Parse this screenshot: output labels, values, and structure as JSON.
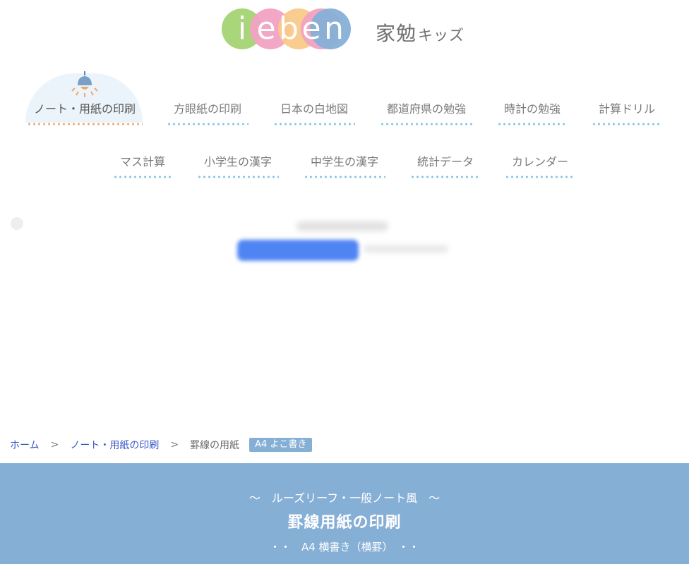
{
  "logo": {
    "letters": [
      "i",
      "e",
      "b",
      "e",
      "n"
    ],
    "colors": [
      "#a9d67a",
      "#f2a2c3",
      "#f9c98a",
      "#f2a2c3",
      "#86afd6"
    ],
    "kanji": "家勉",
    "kana": "キッズ"
  },
  "nav": {
    "row1": [
      {
        "label": "ノート・用紙の印刷",
        "active": true
      },
      {
        "label": "方眼紙の印刷"
      },
      {
        "label": "日本の白地図"
      },
      {
        "label": "都道府県の勉強"
      },
      {
        "label": "時計の勉強"
      },
      {
        "label": "計算ドリル"
      }
    ],
    "row2": [
      {
        "label": "マス計算"
      },
      {
        "label": "小学生の漢字"
      },
      {
        "label": "中学生の漢字"
      },
      {
        "label": "統計データ"
      },
      {
        "label": "カレンダー"
      }
    ],
    "active_icon": "lamp-icon"
  },
  "breadcrumb": {
    "home": "ホーム",
    "separator": ">",
    "category": "ノート・用紙の印刷",
    "current": "罫線の用紙",
    "badge": "A4 よこ書き"
  },
  "hero": {
    "subtitle": "～　ルーズリーフ・一般ノート風　～",
    "title": "罫線用紙の印刷",
    "size": "・・　A4 横書き（横罫）　・・"
  },
  "colors": {
    "accent": "#86afd6",
    "link": "#3a58c7",
    "active_dots": "#f3a56a",
    "dots": "#86c3e6"
  }
}
